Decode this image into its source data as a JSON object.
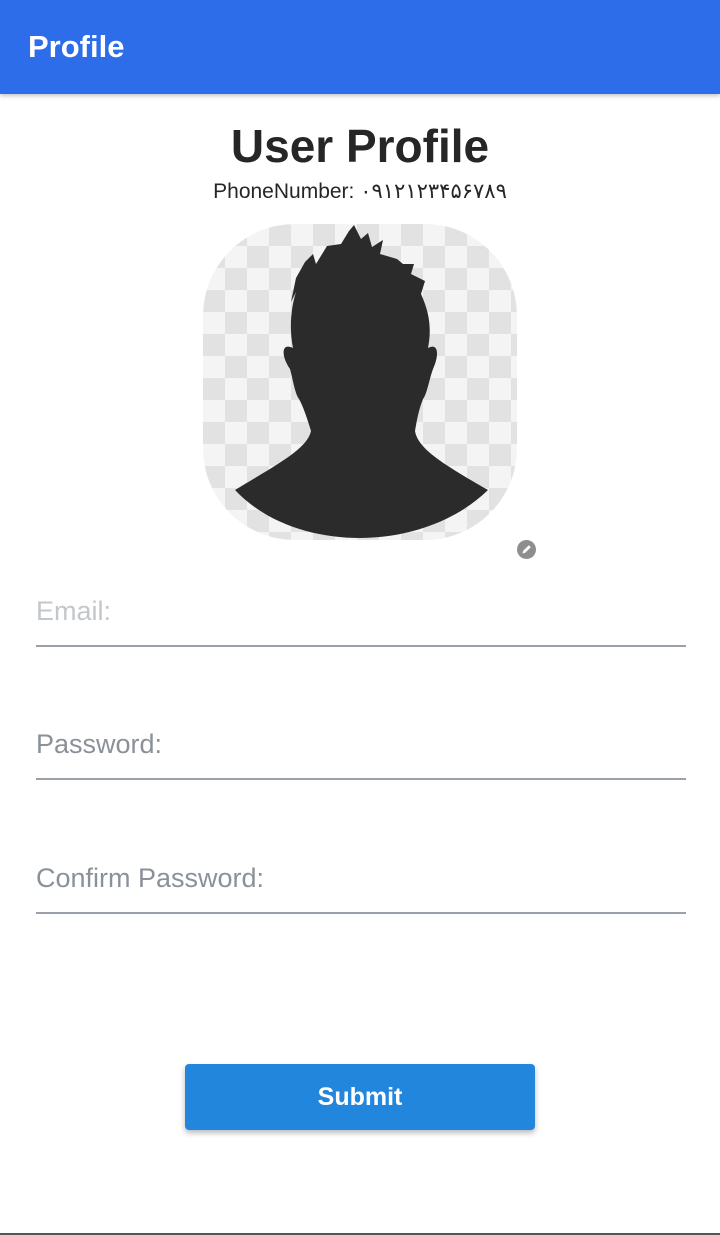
{
  "colors": {
    "accent": "#2d6de9",
    "button": "#2286dd",
    "input_line": "#9aa1a8"
  },
  "appbar": {
    "title": "Profile"
  },
  "profile": {
    "heading": "User Profile",
    "phone_line": "PhoneNumber: ۰۹۱۲۱۲۳۴۵۶۷۸۹",
    "avatar_icon": "person-silhouette-icon",
    "edit_icon": "pencil-icon"
  },
  "form": {
    "email_placeholder": "Email:",
    "email_value": "",
    "password_placeholder": "Password:",
    "password_value": "",
    "confirm_placeholder": "Confirm Password:",
    "confirm_value": "",
    "submit_label": "Submit"
  }
}
